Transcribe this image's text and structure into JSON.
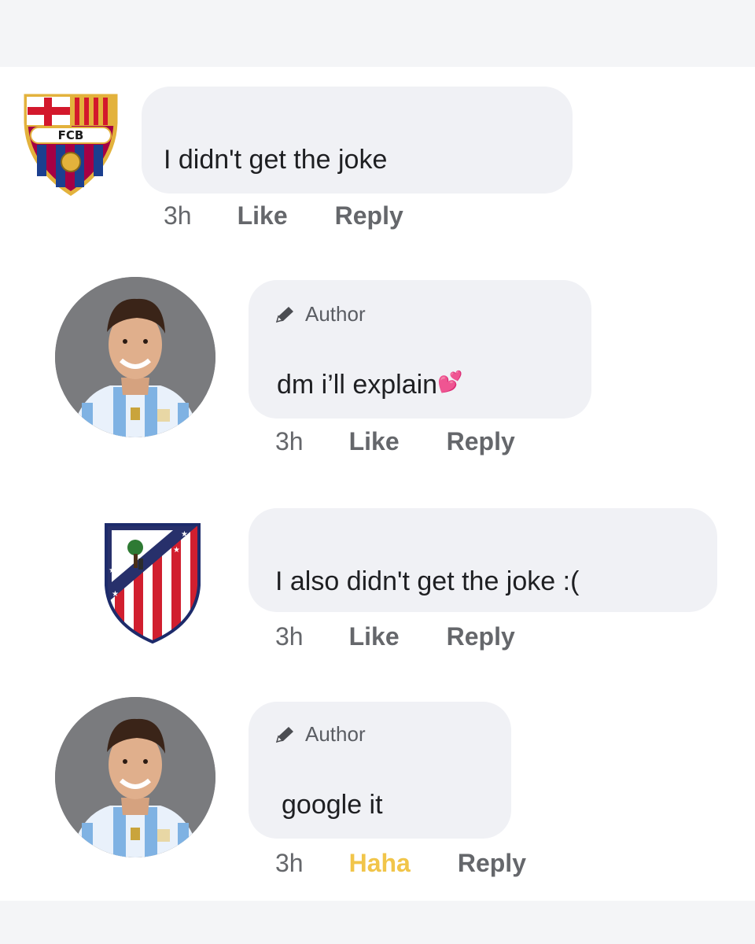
{
  "comments": [
    {
      "avatar": "fc-barcelona-crest-icon",
      "text": "I didn't get the joke",
      "author_badge": "",
      "time": "3h",
      "reaction": "Like",
      "reply": "Reply"
    },
    {
      "avatar": "player-avatar",
      "author_badge": "Author",
      "text": "dm i’ll explain",
      "emoji": "💕",
      "time": "3h",
      "reaction": "Like",
      "reply": "Reply"
    },
    {
      "avatar": "atletico-madrid-crest-icon",
      "text": "I also didn't get the joke :(",
      "author_badge": "",
      "time": "3h",
      "reaction": "Like",
      "reply": "Reply"
    },
    {
      "avatar": "player-avatar",
      "author_badge": "Author",
      "text": "google it",
      "time": "3h",
      "reaction": "Haha",
      "reply": "Reply"
    }
  ],
  "crest_text": {
    "barca": "FCB"
  },
  "colors": {
    "bubble": "#f0f1f5",
    "haha": "#f1c54a",
    "meta": "#65676b"
  }
}
